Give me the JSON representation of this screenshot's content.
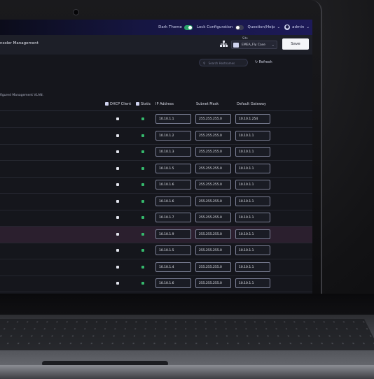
{
  "topbar": {
    "dark_theme_label": "Dark Theme",
    "lock_configuration_label": "Lock Configuration",
    "questions_help_label": "Question/Help",
    "admin_label": "admin"
  },
  "header": {
    "app_title": "nsoler Management",
    "site_label": "Site",
    "site_value": "EMEA_Fly Case",
    "save_label": "Save"
  },
  "toolbar": {
    "search_placeholder": "Search Hostnames",
    "refresh_label": "Refresh"
  },
  "table": {
    "vlan_note": "figured Management VLAN.",
    "columns": {
      "dhcp": "DHCP Client",
      "static": "Static",
      "ip": "IP Address",
      "mask": "Subnet Mask",
      "gateway": "Default Gateway"
    },
    "rows": [
      {
        "ip": "10.10.1.1",
        "mask": "255.255.255.0",
        "gateway": "10.10.1.254"
      },
      {
        "ip": "10.10.1.2",
        "mask": "255.255.255.0",
        "gateway": "10.10.1.1"
      },
      {
        "ip": "10.10.1.3",
        "mask": "255.255.255.0",
        "gateway": "10.10.1.1"
      },
      {
        "ip": "10.10.1.5",
        "mask": "255.255.255.0",
        "gateway": "10.10.1.1"
      },
      {
        "ip": "10.10.1.6",
        "mask": "255.255.255.0",
        "gateway": "10.10.1.1"
      },
      {
        "ip": "10.10.1.6",
        "mask": "255.255.255.0",
        "gateway": "10.10.1.1"
      },
      {
        "ip": "10.10.1.7",
        "mask": "255.255.255.0",
        "gateway": "10.10.1.1"
      },
      {
        "ip": "10.10.1.9",
        "mask": "255.255.255.0",
        "gateway": "10.10.1.1"
      },
      {
        "ip": "10.10.1.5",
        "mask": "255.255.255.0",
        "gateway": "10.10.1.1"
      },
      {
        "ip": "10.10.1.4",
        "mask": "255.255.255.0",
        "gateway": "10.10.1.1"
      },
      {
        "ip": "10.10.1.6",
        "mask": "255.255.255.0",
        "gateway": "10.10.1.1"
      }
    ]
  },
  "colors": {
    "toggle_on": "#2aa36b",
    "static_check": "#35b86c",
    "topbar_accent": "#1d1a58",
    "highlight_row": "#2b1f2e"
  }
}
